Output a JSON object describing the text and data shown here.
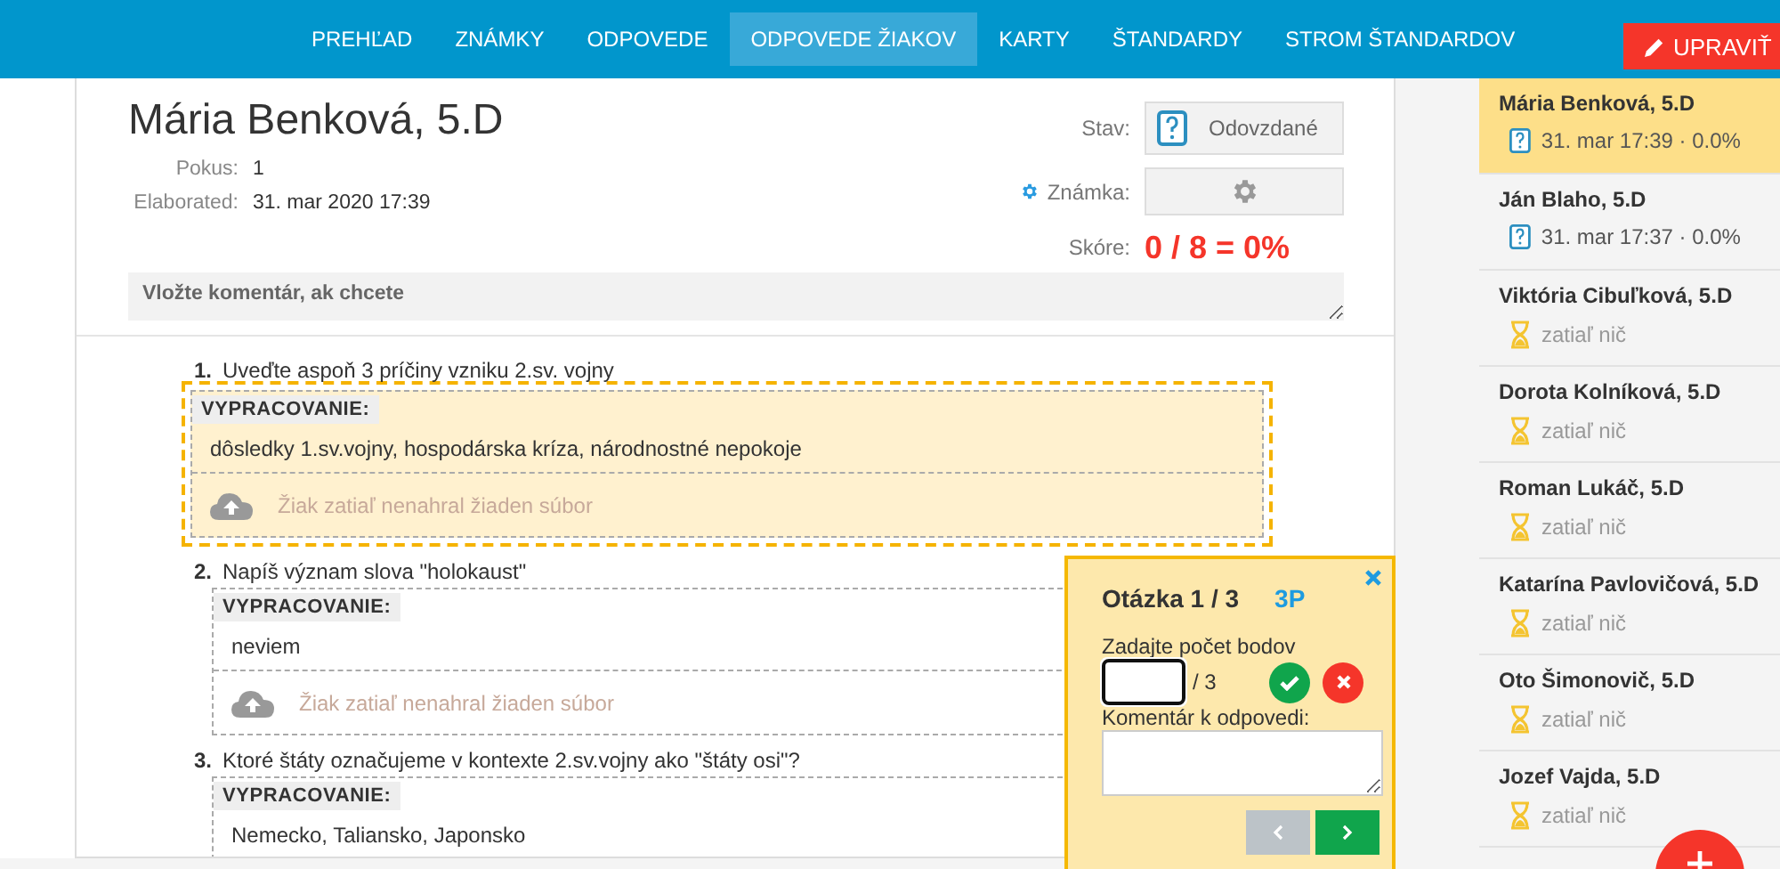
{
  "nav": {
    "items": [
      {
        "label": "PREHĽAD",
        "selected": false
      },
      {
        "label": "ZNÁMKY",
        "selected": false
      },
      {
        "label": "ODPOVEDE",
        "selected": false
      },
      {
        "label": "ODPOVEDE ŽIAKOV",
        "selected": true
      },
      {
        "label": "KARTY",
        "selected": false
      },
      {
        "label": "ŠTANDARDY",
        "selected": false
      },
      {
        "label": "STROM ŠTANDARDOV",
        "selected": false
      }
    ],
    "edit_button": "UPRAVIŤ"
  },
  "header": {
    "student": "Mária Benková, 5.D",
    "details": [
      {
        "label": "Pokus:",
        "value": "1"
      },
      {
        "label": "Elaborated:",
        "value": "31. mar 2020 17:39"
      }
    ],
    "status_label": "Stav:",
    "status": "Odovzdané",
    "grade_label": "Známka:",
    "score_label": "Skóre:",
    "score": "0 / 8 = 0%",
    "comment_placeholder": "Vložte komentár, ak chcete"
  },
  "questions": [
    {
      "number": "1.",
      "text": "Uveďte aspoň 3 príčiny vzniku 2.sv. vojny",
      "answer_label": "VYPRACOVANIE:",
      "answer": "dôsledky 1.sv.vojny, hospodárska kríza, národnostné nepokoje",
      "upload": "Žiak zatiaľ nenahral žiaden súbor",
      "selected": true
    },
    {
      "number": "2.",
      "text": "Napíš význam slova \"holokaust\"",
      "answer_label": "VYPRACOVANIE:",
      "answer": "neviem",
      "upload": "Žiak zatiaľ nenahral žiaden súbor",
      "selected": false
    },
    {
      "number": "3.",
      "text": "Ktoré štáty označujeme v kontexte 2.sv.vojny ako \"štáty osi\"?",
      "answer_label": "VYPRACOVANIE:",
      "answer": "Nemecko, Taliansko, Japonsko",
      "selected": false
    }
  ],
  "grading_popup": {
    "title": "Otázka 1 / 3",
    "points": "3P",
    "points_label": "Zadajte počet bodov",
    "max": "/ 3",
    "comment_label": "Komentár k odpovedi:",
    "prev_disabled": true,
    "next_disabled": false
  },
  "students": [
    {
      "name": "Mária Benková, 5.D",
      "kind": "submitted",
      "info": "31. mar 17:39 · 0.0%",
      "selected": true
    },
    {
      "name": "Ján Blaho, 5.D",
      "kind": "submitted",
      "info": "31. mar 17:37 · 0.0%",
      "selected": false
    },
    {
      "name": "Viktória Cibuľková, 5.D",
      "kind": "waiting",
      "info": "zatiaľ nič",
      "selected": false
    },
    {
      "name": "Dorota Kolníková, 5.D",
      "kind": "waiting",
      "info": "zatiaľ nič",
      "selected": false
    },
    {
      "name": "Roman Lukáč, 5.D",
      "kind": "waiting",
      "info": "zatiaľ nič",
      "selected": false
    },
    {
      "name": "Katarína Pavlovičová, 5.D",
      "kind": "waiting",
      "info": "zatiaľ nič",
      "selected": false
    },
    {
      "name": "Oto Šimonovič, 5.D",
      "kind": "waiting",
      "info": "zatiaľ nič",
      "selected": false
    },
    {
      "name": "Jozef Vajda, 5.D",
      "kind": "waiting",
      "info": "zatiaľ nič",
      "selected": false
    }
  ]
}
